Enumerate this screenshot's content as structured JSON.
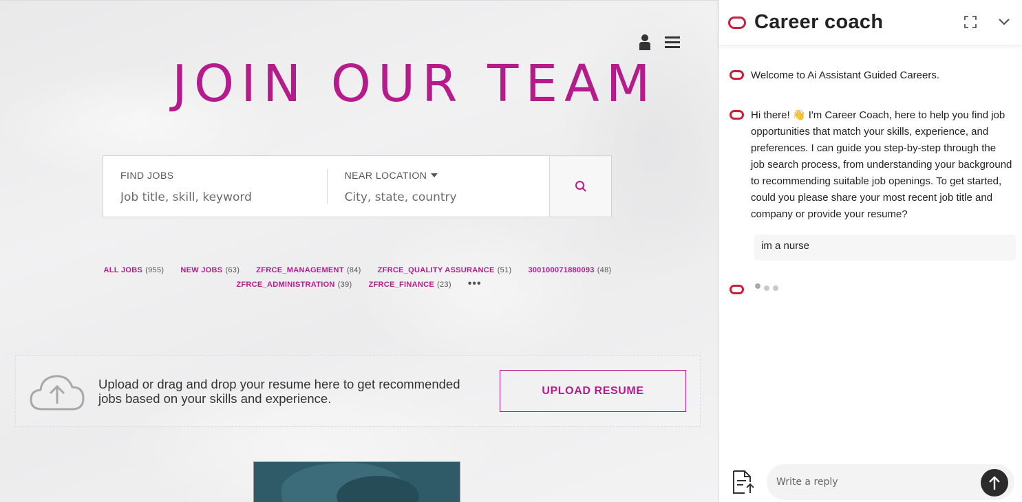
{
  "page": {
    "hero_title": "JOIN OUR TEAM",
    "accent_color": "#b51b8a",
    "search": {
      "find_label": "FIND JOBS",
      "find_placeholder": "Job title, skill, keyword",
      "near_label": "NEAR LOCATION",
      "near_placeholder": "City, state, country"
    },
    "categories_row1": [
      {
        "label": "ALL JOBS",
        "count": "(955)"
      },
      {
        "label": "NEW JOBS",
        "count": "(63)"
      },
      {
        "label": "ZFRCE_MANAGEMENT",
        "count": "(84)"
      },
      {
        "label": "ZFRCE_QUALITY ASSURANCE",
        "count": "(51)"
      },
      {
        "label": "300100071880093",
        "count": "(48)"
      }
    ],
    "categories_row2": [
      {
        "label": "ZFRCE_ADMINISTRATION",
        "count": "(39)"
      },
      {
        "label": "ZFRCE_FINANCE",
        "count": "(23)"
      }
    ],
    "more_label": "•••",
    "upload": {
      "text": "Upload or drag and drop your resume here to get recommended jobs based on your skills and experience.",
      "button_label": "UPLOAD RESUME"
    }
  },
  "chat": {
    "title": "Career coach",
    "brand_color": "#c8203a",
    "messages": [
      {
        "text": "Welcome to Ai Assistant Guided Careers."
      },
      {
        "text": "Hi there! 👋 I'm Career Coach, here to help you find job opportunities that match your skills, experience, and preferences. I can guide you step-by-step through the job search process, from understanding your background to recommending suitable job openings. To get started, could you please share your most recent job title and company or provide your resume?"
      }
    ],
    "user_message": "im a nurse",
    "reply_placeholder": "Write a reply"
  }
}
